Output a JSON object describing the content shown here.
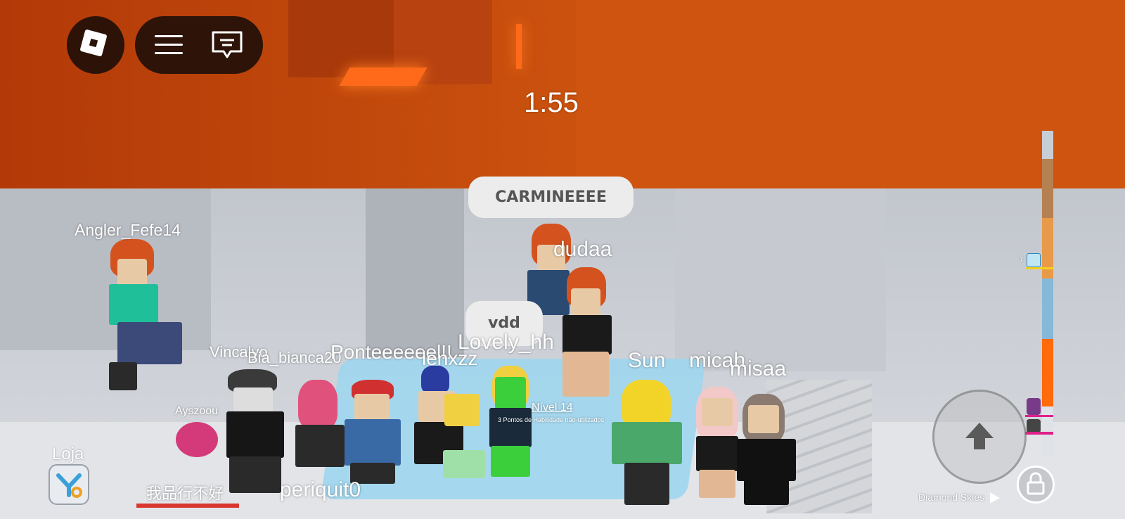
{
  "hud": {
    "timer": "1:55",
    "menu_icon": "hamburger-menu-icon",
    "chat_icon": "chat-icon",
    "logo_icon": "roblox-logo-icon"
  },
  "chat_bubbles": [
    {
      "text": "CARMINEEEE"
    },
    {
      "text": "vdd"
    }
  ],
  "players": [
    {
      "name": "Angler_Fefe14"
    },
    {
      "name": "dudaa"
    },
    {
      "name": "Vincalyo"
    },
    {
      "name": "Bia_bianca20"
    },
    {
      "name": "Ponteeeeeel!!"
    },
    {
      "name": "Lovely_hh"
    },
    {
      "name": "lenxzz"
    },
    {
      "name": "Sun"
    },
    {
      "name": "micah"
    },
    {
      "name": "misaa"
    },
    {
      "name": "Ayszoou"
    },
    {
      "name": "periquit0"
    },
    {
      "name": "我品行不好"
    }
  ],
  "level_tag": {
    "label": "Nível 14",
    "sub": "3 Pontos de Habilidade não-utilizados"
  },
  "shop": {
    "label": "Loja",
    "icon": "shop-icon"
  },
  "height_bar": {
    "marker_count": "7"
  },
  "music": {
    "track": "Diamond Skies",
    "play_icon": "play-icon"
  },
  "controls": {
    "jump_icon": "jump-arrow-icon",
    "lock_icon": "shift-lock-icon"
  },
  "colors": {
    "ceiling": "#c24a0c",
    "hud_bg": "#1e0e08",
    "accent": "#ff6a1a"
  }
}
